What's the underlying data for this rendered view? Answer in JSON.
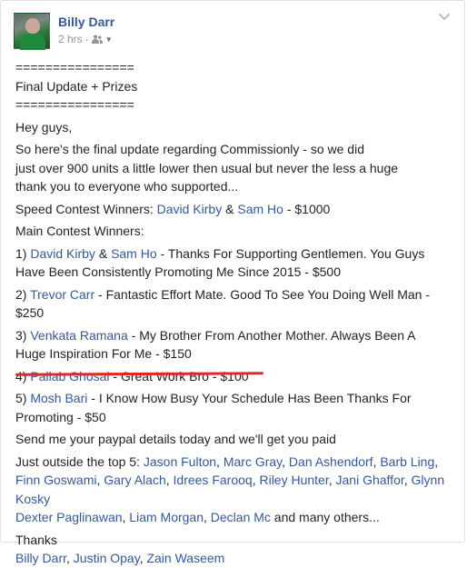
{
  "post": {
    "author": "Billy Darr",
    "timestamp": "2 hrs",
    "sep": "·"
  },
  "body": {
    "rule1": "================",
    "heading": "Final Update + Prizes",
    "rule2": "================",
    "greeting": "Hey guys,",
    "intro_l1": "So here's the final update regarding Commissionly - so we did",
    "intro_l2": "just over 900 units a little lower then usual but never the less a huge",
    "intro_l3": "thank you to everyone who supported...",
    "speed_label": "Speed Contest Winners: ",
    "speed_w1": "David Kirby",
    "amp": " & ",
    "speed_w2": "Sam Ho",
    "speed_prize": " - $1000",
    "main_label": "Main Contest Winners:",
    "p1_num": "1) ",
    "p1_w1": "David Kirby",
    "p1_w2": "Sam Ho",
    "p1_text_a": " - Thanks For Supporting Gentlemen. You Guys",
    "p1_text_b": "Have Been Consistently Promoting Me Since 2015 - $500",
    "p2_num": "2) ",
    "p2_w": "Trevor Carr",
    "p2_text_a": " - Fantastic Effort Mate. Good To See You Doing Well Man -",
    "p2_text_b": "$250",
    "p3_num": "3) ",
    "p3_w": "Venkata Ramana",
    "p3_text_a": " - My Brother From Another Mother. Always Been A",
    "p3_text_b": "Huge Inspiration For Me - $150",
    "p4_num": "4) ",
    "p4_w": "Pallab Ghosal",
    "p4_text": " - Great Work Bro - $100",
    "p5_num": "5) ",
    "p5_w": "Mosh Bari",
    "p5_text_a": " - I Know How Busy Your Schedule Has Been Thanks For",
    "p5_text_b": "Promoting - $50",
    "paypal": "Send me your paypal details today and we'll get you paid",
    "outside_label": "Just outside the top 5: ",
    "outside_names": [
      "Jason Fulton",
      "Marc Gray",
      "Dan Ashendorf",
      "Barb Ling",
      "Finn Goswami",
      "Gary Alach",
      "Idrees Farooq",
      "Riley Hunter",
      "Jani Ghaffor",
      "Glynn Kosky",
      "Dexter Paglinawan",
      "Liam Morgan",
      "Declan Mc"
    ],
    "comma": ", ",
    "outside_tail": " and many others...",
    "thanks": "Thanks",
    "signers": [
      "Billy Darr",
      "Justin Opay",
      "Zain Waseem"
    ]
  },
  "colors": {
    "link": "#365899",
    "text": "#1d2129",
    "meta": "#90949c",
    "highlight_underline": "#e0262c"
  },
  "icons": {
    "audience": "friends-icon",
    "menu": "chevron-down-icon"
  }
}
